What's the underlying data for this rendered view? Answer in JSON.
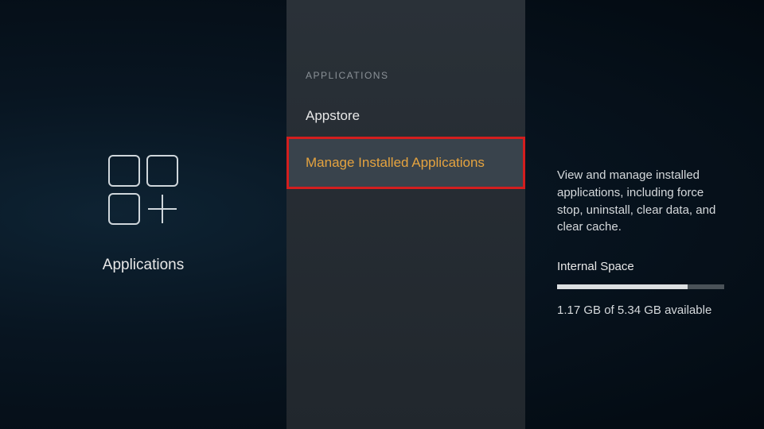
{
  "left": {
    "title": "Applications"
  },
  "middle": {
    "header": "APPLICATIONS",
    "items": [
      {
        "label": "Appstore",
        "selected": false
      },
      {
        "label": "Manage Installed Applications",
        "selected": true
      }
    ]
  },
  "right": {
    "description": "View and manage installed applications, including force stop, uninstall, clear data, and clear cache.",
    "storage_label": "Internal Space",
    "storage_used_gb": 1.17,
    "storage_total_gb": 5.34,
    "storage_text": "1.17 GB of 5.34 GB available",
    "storage_fill_percent": 78
  }
}
